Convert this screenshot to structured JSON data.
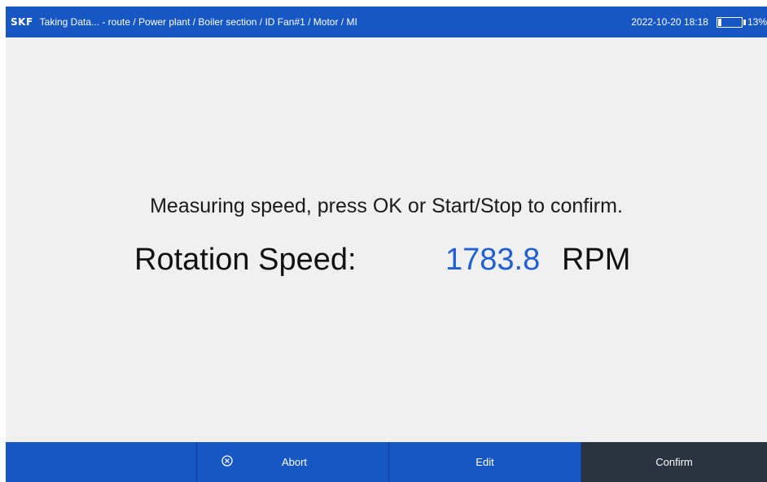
{
  "topbar": {
    "logo": "SKF",
    "title": "Taking Data... - route / Power plant / Boiler section / ID Fan#1 / Motor / MI",
    "datetime": "2022-10-20 18:18",
    "battery_percent_text": "13%",
    "battery_level": 0.13,
    "background_color": "#1757c4"
  },
  "main": {
    "message": "Measuring speed, press OK or Start/Stop to confirm.",
    "speed_label": "Rotation Speed:",
    "speed_value": "1783.8",
    "speed_unit": "RPM",
    "value_color": "#1f5fcf"
  },
  "bottombar": {
    "abort_icon": "circle-x-icon",
    "abort_label": "Abort",
    "edit_label": "Edit",
    "confirm_label": "Confirm",
    "confirm_color": "#2a3441"
  }
}
